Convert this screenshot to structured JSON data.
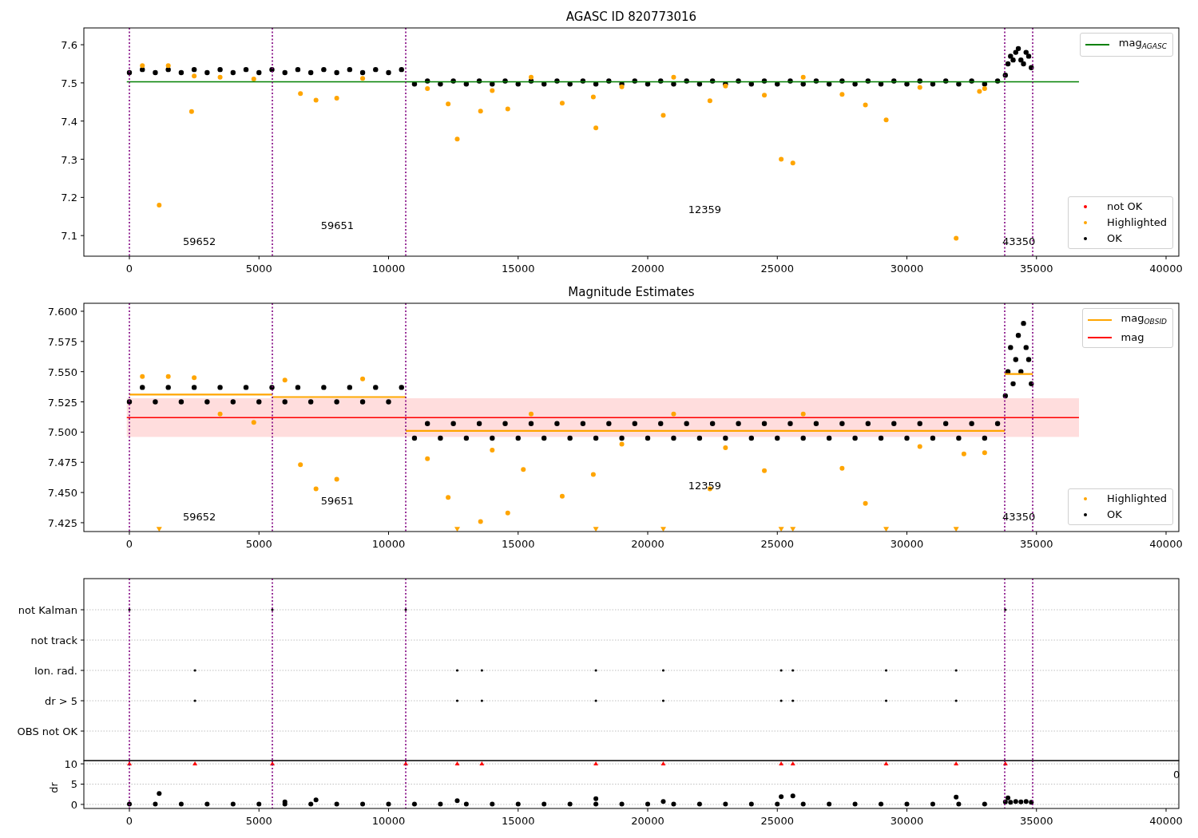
{
  "panels": [
    {
      "chart_data": {
        "type": "scatter",
        "title": "AGASC ID 820773016",
        "xlim": [
          -1757,
          40493
        ],
        "ylim": [
          7.046,
          7.644
        ],
        "xticks": [
          {
            "value": 0,
            "label": "0"
          },
          {
            "value": 5000,
            "label": "5000"
          },
          {
            "value": 10000,
            "label": "10000"
          },
          {
            "value": 15000,
            "label": "15000"
          },
          {
            "value": 20000,
            "label": "20000"
          },
          {
            "value": 25000,
            "label": "25000"
          },
          {
            "value": 30000,
            "label": "30000"
          },
          {
            "value": 35000,
            "label": "35000"
          },
          {
            "value": 40000,
            "label": "40000"
          }
        ],
        "yticks": [
          {
            "value": 7.1,
            "label": "7.1"
          },
          {
            "value": 7.2,
            "label": "7.2"
          },
          {
            "value": 7.3,
            "label": "7.3"
          },
          {
            "value": 7.4,
            "label": "7.4"
          },
          {
            "value": 7.5,
            "label": "7.5"
          },
          {
            "value": 7.6,
            "label": "7.6"
          }
        ],
        "series": [
          {
            "color": "#000000",
            "x": [
              0,
              500,
              1000,
              1500,
              2000,
              2500,
              3000,
              3500,
              4000,
              4500,
              5000,
              5500,
              6000,
              6500,
              7000,
              7500,
              8000,
              8500,
              9000,
              9500,
              10000,
              10500,
              11000,
              11500,
              12000,
              12500,
              13000,
              13500,
              14000,
              14500,
              15000,
              15500,
              16000,
              16500,
              17000,
              17500,
              18000,
              18500,
              19000,
              19500,
              20000,
              20500,
              21000,
              21500,
              22000,
              22500,
              23000,
              23500,
              24000,
              24500,
              25000,
              25500,
              26000,
              26500,
              27000,
              27500,
              28000,
              28500,
              29000,
              29500,
              30000,
              30500,
              31000,
              31500,
              32000,
              32500,
              33000,
              33500,
              33800,
              33900,
              34000,
              34100,
              34200,
              34300,
              34400,
              34500,
              34600,
              34700,
              34800
            ],
            "values": [
              7.527,
              7.535,
              7.527,
              7.535,
              7.527,
              7.535,
              7.527,
              7.535,
              7.527,
              7.535,
              7.527,
              7.535,
              7.527,
              7.535,
              7.527,
              7.535,
              7.527,
              7.535,
              7.527,
              7.535,
              7.527,
              7.535,
              7.497,
              7.505,
              7.497,
              7.505,
              7.497,
              7.505,
              7.497,
              7.505,
              7.497,
              7.505,
              7.497,
              7.505,
              7.497,
              7.505,
              7.497,
              7.505,
              7.497,
              7.505,
              7.497,
              7.505,
              7.497,
              7.505,
              7.497,
              7.505,
              7.497,
              7.505,
              7.497,
              7.505,
              7.497,
              7.505,
              7.497,
              7.505,
              7.497,
              7.505,
              7.497,
              7.505,
              7.497,
              7.505,
              7.497,
              7.505,
              7.497,
              7.505,
              7.497,
              7.505,
              7.497,
              7.505,
              7.52,
              7.55,
              7.57,
              7.56,
              7.58,
              7.59,
              7.56,
              7.55,
              7.58,
              7.57,
              7.54
            ]
          },
          {
            "color": "#ffa500",
            "x": [
              1150,
              2400,
              6600,
              7200,
              8000,
              12300,
              12650,
              13550,
              14600,
              16700,
              17900,
              18000,
              20600,
              22400,
              24500,
              25150,
              25600,
              28400,
              29200,
              31900,
              32800,
              500,
              1500,
              2500,
              3500,
              4800,
              9000,
              11500,
              14000,
              19000,
              23000,
              27500,
              30500,
              33000,
              15500,
              21000,
              26000
            ],
            "values": [
              7.18,
              7.425,
              7.472,
              7.455,
              7.46,
              7.445,
              7.353,
              7.426,
              7.432,
              7.447,
              7.463,
              7.382,
              7.415,
              7.453,
              7.468,
              7.3,
              7.29,
              7.442,
              7.403,
              7.093,
              7.478,
              7.545,
              7.545,
              7.518,
              7.515,
              7.51,
              7.512,
              7.485,
              7.48,
              7.49,
              7.492,
              7.47,
              7.488,
              7.485,
              7.515,
              7.515,
              7.515
            ]
          }
        ],
        "ref_lines": [
          {
            "axis": "y",
            "value": 7.503,
            "color": "#008000"
          },
          {
            "axis": "x",
            "value": 0,
            "color": "#800080"
          },
          {
            "axis": "x",
            "value": 5516,
            "color": "#800080"
          },
          {
            "axis": "x",
            "value": 10663,
            "color": "#800080"
          },
          {
            "axis": "x",
            "value": 33775,
            "color": "#800080"
          },
          {
            "axis": "x",
            "value": 34854,
            "color": "#800080"
          }
        ],
        "annotations": [
          "59652",
          "59651",
          "12359",
          "43350"
        ]
      },
      "legends": [
        [
          {
            "kind": "line",
            "label": "mag$_{AGASC}$",
            "color": "#008000"
          }
        ],
        [
          {
            "kind": "dot",
            "label": "not OK",
            "color": "#ff0000"
          },
          {
            "kind": "dot",
            "label": "Highlighted",
            "color": "#ffa500"
          },
          {
            "kind": "dot",
            "label": "OK",
            "color": "#000000"
          }
        ]
      ]
    },
    {
      "chart_data": {
        "type": "scatter",
        "title": "Magnitude Estimates",
        "xlim": [
          -1757,
          40493
        ],
        "ylim": [
          7.4177,
          7.6066
        ],
        "xticks": [
          {
            "value": 0,
            "label": "0"
          },
          {
            "value": 5000,
            "label": "5000"
          },
          {
            "value": 10000,
            "label": "10000"
          },
          {
            "value": 15000,
            "label": "15000"
          },
          {
            "value": 20000,
            "label": "20000"
          },
          {
            "value": 25000,
            "label": "25000"
          },
          {
            "value": 30000,
            "label": "30000"
          },
          {
            "value": 35000,
            "label": "35000"
          },
          {
            "value": 40000,
            "label": "40000"
          }
        ],
        "yticks": [
          {
            "value": 7.425,
            "label": "7.425"
          },
          {
            "value": 7.45,
            "label": "7.450"
          },
          {
            "value": 7.475,
            "label": "7.475"
          },
          {
            "value": 7.5,
            "label": "7.500"
          },
          {
            "value": 7.525,
            "label": "7.525"
          },
          {
            "value": 7.55,
            "label": "7.550"
          },
          {
            "value": 7.575,
            "label": "7.575"
          },
          {
            "value": 7.6,
            "label": "7.600"
          }
        ],
        "bands": [
          {
            "axis": "y",
            "from": 7.496,
            "to": 7.528,
            "color": "#ffdddd"
          }
        ],
        "series": [
          {
            "color": "#000000",
            "x": [
              0,
              500,
              1000,
              1500,
              2000,
              2500,
              3000,
              3500,
              4000,
              4500,
              5000,
              5500,
              6000,
              6500,
              7000,
              7500,
              8000,
              8500,
              9000,
              9500,
              10000,
              10500,
              11000,
              11500,
              12000,
              12500,
              13000,
              13500,
              14000,
              14500,
              15000,
              15500,
              16000,
              16500,
              17000,
              17500,
              18000,
              18500,
              19000,
              19500,
              20000,
              20500,
              21000,
              21500,
              22000,
              22500,
              23000,
              23500,
              24000,
              24500,
              25000,
              25500,
              26000,
              26500,
              27000,
              27500,
              28000,
              28500,
              29000,
              29500,
              30000,
              30500,
              31000,
              31500,
              32000,
              32500,
              33000,
              33500,
              33800,
              33900,
              34000,
              34100,
              34200,
              34300,
              34400,
              34500,
              34600,
              34700,
              34800
            ],
            "values": [
              7.525,
              7.537,
              7.525,
              7.537,
              7.525,
              7.537,
              7.525,
              7.537,
              7.525,
              7.537,
              7.525,
              7.537,
              7.525,
              7.537,
              7.525,
              7.537,
              7.525,
              7.537,
              7.525,
              7.537,
              7.525,
              7.537,
              7.495,
              7.507,
              7.495,
              7.507,
              7.495,
              7.507,
              7.495,
              7.507,
              7.495,
              7.507,
              7.495,
              7.507,
              7.495,
              7.507,
              7.495,
              7.507,
              7.495,
              7.507,
              7.495,
              7.507,
              7.495,
              7.507,
              7.495,
              7.507,
              7.495,
              7.507,
              7.495,
              7.507,
              7.495,
              7.507,
              7.495,
              7.507,
              7.495,
              7.507,
              7.495,
              7.507,
              7.495,
              7.507,
              7.495,
              7.507,
              7.495,
              7.507,
              7.495,
              7.507,
              7.495,
              7.507,
              7.53,
              7.55,
              7.57,
              7.54,
              7.56,
              7.58,
              7.55,
              7.59,
              7.57,
              7.56,
              7.54
            ]
          },
          {
            "color": "#ffa500",
            "x": [
              6600,
              7200,
              8000,
              12300,
              13550,
              14600,
              15200,
              16700,
              17900,
              22400,
              24500,
              28400,
              32200,
              500,
              1500,
              2500,
              3500,
              4800,
              6000,
              9000,
              11500,
              14000,
              19000,
              23000,
              27500,
              30500,
              33000,
              15500,
              21000,
              26000
            ],
            "values": [
              7.473,
              7.453,
              7.461,
              7.446,
              7.426,
              7.433,
              7.469,
              7.447,
              7.465,
              7.453,
              7.468,
              7.441,
              7.482,
              7.546,
              7.546,
              7.545,
              7.515,
              7.508,
              7.543,
              7.544,
              7.478,
              7.485,
              7.49,
              7.487,
              7.47,
              7.488,
              7.483,
              7.515,
              7.515,
              7.515
            ]
          },
          {
            "color": "#ffa500",
            "x": [
              1150,
              12650,
              18000,
              20600,
              25150,
              25600,
              29200,
              31900
            ],
            "values": [
              7.4195,
              7.4195,
              7.4195,
              7.4195,
              7.4195,
              7.4195,
              7.4195,
              7.4195
            ]
          },
          {
            "type": "line",
            "color": "#ffa500",
            "x": [
              0,
              5516
            ],
            "values": [
              7.531,
              7.531
            ]
          },
          {
            "type": "line",
            "color": "#ffa500",
            "x": [
              5516,
              10663
            ],
            "values": [
              7.529,
              7.529
            ]
          },
          {
            "type": "line",
            "color": "#ffa500",
            "x": [
              10663,
              33775
            ],
            "values": [
              7.501,
              7.501
            ]
          },
          {
            "type": "line",
            "color": "#ffa500",
            "x": [
              33775,
              34854
            ],
            "values": [
              7.548,
              7.548
            ]
          }
        ],
        "ref_lines": [
          {
            "axis": "y",
            "value": 7.512,
            "color": "#ff0000"
          },
          {
            "axis": "x",
            "value": 0,
            "color": "#800080"
          },
          {
            "axis": "x",
            "value": 5516,
            "color": "#800080"
          },
          {
            "axis": "x",
            "value": 10663,
            "color": "#800080"
          },
          {
            "axis": "x",
            "value": 33775,
            "color": "#800080"
          },
          {
            "axis": "x",
            "value": 34854,
            "color": "#800080"
          }
        ],
        "annotations": [
          "59652",
          "59651",
          "12359",
          "43350"
        ]
      },
      "legends": [
        [
          {
            "kind": "line",
            "label": "mag$_{OBSID}$",
            "color": "#ffa500"
          },
          {
            "kind": "line",
            "label": "mag",
            "color": "#ff0000"
          }
        ],
        [
          {
            "kind": "dot",
            "label": "Highlighted",
            "color": "#ffa500"
          },
          {
            "kind": "dot",
            "label": "OK",
            "color": "#000000"
          }
        ]
      ]
    },
    {
      "flag_labels": [
        "not Kalman",
        "not track",
        "Ion. rad.",
        "dr > 5",
        "OBS not OK"
      ],
      "hidden_tick_fragment": "0"
    },
    {
      "chart_data": {
        "type": "scatter",
        "grid": true,
        "ylabel": "dr",
        "xlim": [
          -1757,
          40493
        ],
        "ylim": [
          -1,
          10.8
        ],
        "xticks": [
          {
            "value": 0,
            "label": "0"
          },
          {
            "value": 5000,
            "label": "5000"
          },
          {
            "value": 10000,
            "label": "10000"
          },
          {
            "value": 15000,
            "label": "15000"
          },
          {
            "value": 20000,
            "label": "20000"
          },
          {
            "value": 25000,
            "label": "25000"
          },
          {
            "value": 30000,
            "label": "30000"
          },
          {
            "value": 35000,
            "label": "35000"
          },
          {
            "value": 40000,
            "label": "40000"
          }
        ],
        "yticks": [
          {
            "value": 0,
            "label": "0"
          },
          {
            "value": 5,
            "label": "5"
          },
          {
            "value": 10,
            "label": "10"
          }
        ],
        "series": [
          {
            "color": "#000000",
            "x": [
              0,
              1000,
              2000,
              3000,
              4000,
              5000,
              6000,
              7000,
              8000,
              9000,
              10000,
              11000,
              12000,
              13000,
              14000,
              15000,
              16000,
              17000,
              18000,
              19000,
              20000,
              21000,
              22000,
              23000,
              24000,
              25000,
              26000,
              27000,
              28000,
              29000,
              30000,
              31000,
              32000,
              33000,
              33800,
              34000,
              34200,
              34400,
              34600,
              34800,
              1150,
              18000,
              25150,
              25600,
              31900,
              6000,
              7200,
              12650,
              20600,
              33900
            ],
            "values": [
              0.1,
              0.1,
              0.1,
              0.1,
              0.1,
              0.1,
              0.1,
              0.1,
              0.1,
              0.1,
              0.1,
              0.1,
              0.1,
              0.1,
              0.1,
              0.1,
              0.1,
              0.1,
              0.1,
              0.1,
              0.1,
              0.1,
              0.1,
              0.1,
              0.1,
              0.1,
              0.1,
              0.1,
              0.1,
              0.1,
              0.1,
              0.1,
              0.1,
              0.1,
              0.6,
              0.5,
              0.7,
              0.6,
              0.7,
              0.5,
              2.7,
              1.4,
              1.9,
              2.1,
              1.8,
              0.6,
              1.1,
              0.9,
              0.7,
              1.6
            ]
          },
          {
            "color": "#ff0000",
            "x": [
              0,
              5516,
              10663,
              33800,
              2530,
              12650,
              13600,
              18000,
              20600,
              25150,
              25600,
              29200,
              31900
            ],
            "values": [
              10,
              10,
              10,
              10,
              10,
              10,
              10,
              10,
              10,
              10,
              10,
              10,
              10
            ]
          }
        ],
        "ref_lines": [
          {
            "axis": "x",
            "value": 0,
            "color": "#800080"
          },
          {
            "axis": "x",
            "value": 5516,
            "color": "#800080"
          },
          {
            "axis": "x",
            "value": 10663,
            "color": "#800080"
          },
          {
            "axis": "x",
            "value": 33775,
            "color": "#800080"
          },
          {
            "axis": "x",
            "value": 34854,
            "color": "#800080"
          }
        ]
      }
    }
  ]
}
